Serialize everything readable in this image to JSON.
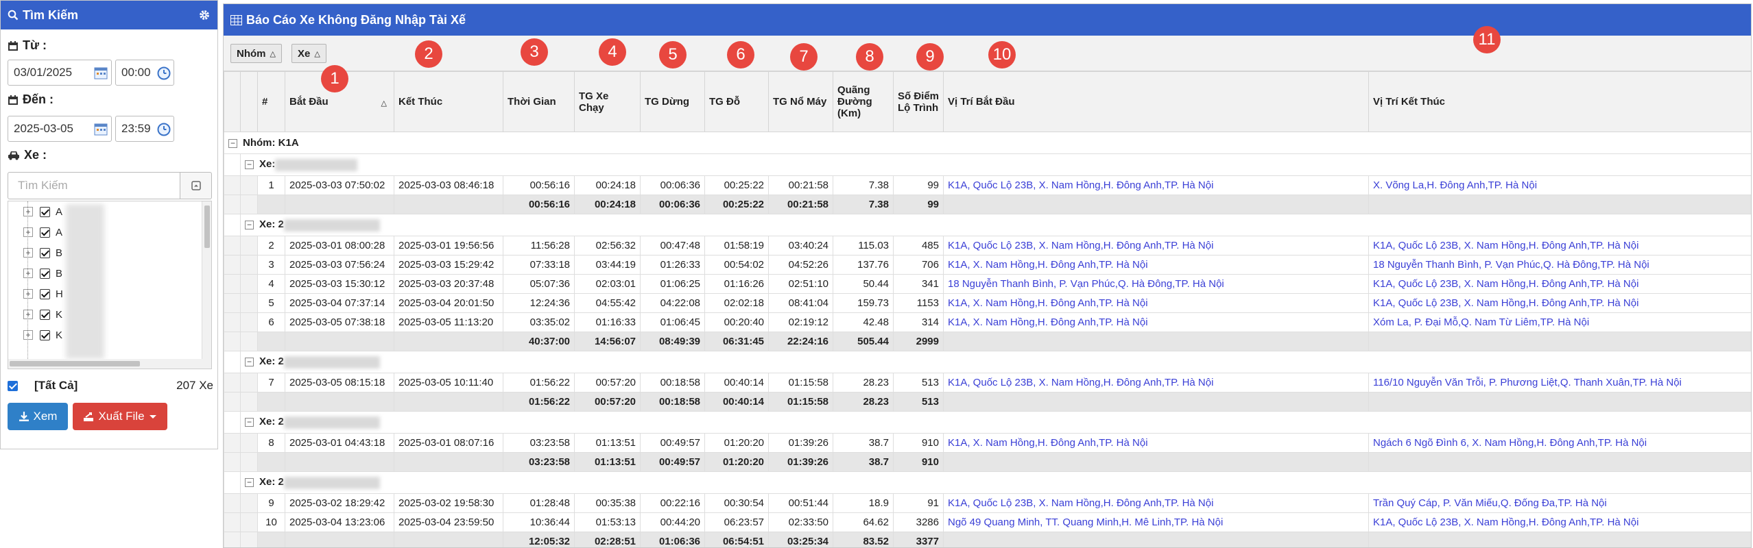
{
  "search_panel": {
    "title": "Tìm Kiếm",
    "from_label": "Từ :",
    "from_date": "03/01/2025",
    "from_time": "00:00",
    "to_label": "Đến :",
    "to_date": "2025-03-05",
    "to_time": "23:59",
    "vehicle_label": "Xe :",
    "search_placeholder": "Tìm Kiếm",
    "tree_items": [
      "A",
      "A",
      "B",
      "B",
      "H",
      "K",
      "K"
    ],
    "select_all_label": "[Tất Cả]",
    "vehicle_count": "207 Xe",
    "view_button": "Xem",
    "export_button": "Xuất File"
  },
  "report": {
    "title": "Báo Cáo Xe Không Đăng Nhập Tài Xế",
    "group_chips": [
      "Nhóm",
      "Xe"
    ],
    "columns": [
      "#",
      "Bắt Đầu",
      "Kết Thúc",
      "Thời Gian",
      "TG Xe Chạy",
      "TG Dừng",
      "TG Đỗ",
      "TG Nổ Máy",
      "Quãng Đường (Km)",
      "Số Điểm Lộ Trình",
      "Vị Trí Bắt Đầu",
      "Vị Trí Kết Thúc"
    ],
    "group_label": "Nhóm: K1A",
    "vehicle_prefix": [
      "Xe:",
      "Xe: 2",
      "Xe: 2",
      "Xe: 2",
      "Xe: 2"
    ],
    "rows": [
      [
        "1",
        "2025-03-03 07:50:02",
        "2025-03-03 08:46:18",
        "00:56:16",
        "00:24:18",
        "00:06:36",
        "00:25:22",
        "00:21:58",
        "7.38",
        "99",
        "K1A, Quốc Lộ 23B, X. Nam Hồng,H. Đông Anh,TP. Hà Nội",
        "X. Võng La,H. Đông Anh,TP. Hà Nội"
      ],
      [
        "2",
        "2025-03-01 08:00:28",
        "2025-03-01 19:56:56",
        "11:56:28",
        "02:56:32",
        "00:47:48",
        "01:58:19",
        "03:40:24",
        "115.03",
        "485",
        "K1A, Quốc Lộ 23B, X. Nam Hồng,H. Đông Anh,TP. Hà Nội",
        "K1A, Quốc Lộ 23B, X. Nam Hồng,H. Đông Anh,TP. Hà Nội"
      ],
      [
        "3",
        "2025-03-03 07:56:24",
        "2025-03-03 15:29:42",
        "07:33:18",
        "03:44:19",
        "01:26:33",
        "00:54:02",
        "04:52:26",
        "137.76",
        "706",
        "K1A, X. Nam Hồng,H. Đông Anh,TP. Hà Nội",
        "18 Nguyễn Thanh Bình, P. Vạn Phúc,Q. Hà Đông,TP. Hà Nội"
      ],
      [
        "4",
        "2025-03-03 15:30:12",
        "2025-03-03 20:37:48",
        "05:07:36",
        "02:03:01",
        "01:06:25",
        "01:16:26",
        "02:51:10",
        "50.44",
        "341",
        "18 Nguyễn Thanh Bình, P. Vạn Phúc,Q. Hà Đông,TP. Hà Nội",
        "K1A, Quốc Lộ 23B, X. Nam Hồng,H. Đông Anh,TP. Hà Nội"
      ],
      [
        "5",
        "2025-03-04 07:37:14",
        "2025-03-04 20:01:50",
        "12:24:36",
        "04:55:42",
        "04:22:08",
        "02:02:18",
        "08:41:04",
        "159.73",
        "1153",
        "K1A, X. Nam Hồng,H. Đông Anh,TP. Hà Nội",
        "K1A, Quốc Lộ 23B, X. Nam Hồng,H. Đông Anh,TP. Hà Nội"
      ],
      [
        "6",
        "2025-03-05 07:38:18",
        "2025-03-05 11:13:20",
        "03:35:02",
        "01:16:33",
        "01:06:45",
        "00:20:40",
        "02:19:12",
        "42.48",
        "314",
        "K1A, X. Nam Hồng,H. Đông Anh,TP. Hà Nội",
        "Xóm La, P. Đại Mỗ,Q. Nam Từ Liêm,TP. Hà Nội"
      ],
      [
        "7",
        "2025-03-05 08:15:18",
        "2025-03-05 10:11:40",
        "01:56:22",
        "00:57:20",
        "00:18:58",
        "00:40:14",
        "01:15:58",
        "28.23",
        "513",
        "K1A, Quốc Lộ 23B, X. Nam Hồng,H. Đông Anh,TP. Hà Nội",
        "116/10 Nguyễn Văn Trỗi, P. Phương Liệt,Q. Thanh Xuân,TP. Hà Nội"
      ],
      [
        "8",
        "2025-03-01 04:43:18",
        "2025-03-01 08:07:16",
        "03:23:58",
        "01:13:51",
        "00:49:57",
        "01:20:20",
        "01:39:26",
        "38.7",
        "910",
        "K1A, X. Nam Hồng,H. Đông Anh,TP. Hà Nội",
        "Ngách 6 Ngõ Đình 6, X. Nam Hồng,H. Đông Anh,TP. Hà Nội"
      ],
      [
        "9",
        "2025-03-02 18:29:42",
        "2025-03-02 19:58:30",
        "01:28:48",
        "00:35:38",
        "00:22:16",
        "00:30:54",
        "00:51:44",
        "18.9",
        "91",
        "K1A, Quốc Lộ 23B, X. Nam Hồng,H. Đông Anh,TP. Hà Nội",
        "Trần Quý Cáp, P. Văn Miếu,Q. Đống Đa,TP. Hà Nội"
      ],
      [
        "10",
        "2025-03-04 13:23:06",
        "2025-03-04 23:59:50",
        "10:36:44",
        "01:53:13",
        "00:44:20",
        "06:23:57",
        "02:33:50",
        "64.62",
        "3286",
        "Ngõ 49 Quang Minh, TT. Quang Minh,H. Mê Linh,TP. Hà Nội",
        "K1A, Quốc Lộ 23B, X. Nam Hồng,H. Đông Anh,TP. Hà Nội"
      ]
    ],
    "subtotals": [
      [
        "00:56:16",
        "00:24:18",
        "00:06:36",
        "00:25:22",
        "00:21:58",
        "7.38",
        "99"
      ],
      [
        "40:37:00",
        "14:56:07",
        "08:49:39",
        "06:31:45",
        "22:24:16",
        "505.44",
        "2999"
      ],
      [
        "01:56:22",
        "00:57:20",
        "00:18:58",
        "00:40:14",
        "01:15:58",
        "28.23",
        "513"
      ],
      [
        "03:23:58",
        "01:13:51",
        "00:49:57",
        "01:20:20",
        "01:39:26",
        "38.7",
        "910"
      ],
      [
        "12:05:32",
        "02:28:51",
        "01:06:36",
        "06:54:51",
        "03:25:34",
        "83.52",
        "3377"
      ]
    ]
  },
  "annotation_badges": [
    "1",
    "2",
    "3",
    "4",
    "5",
    "6",
    "7",
    "8",
    "9",
    "10",
    "11"
  ],
  "colors": {
    "header_blue": "#3561c9",
    "link_blue": "#3a3fd6",
    "badge_red": "#e8473f",
    "view_button": "#2f80c8",
    "export_button": "#d9433b"
  }
}
